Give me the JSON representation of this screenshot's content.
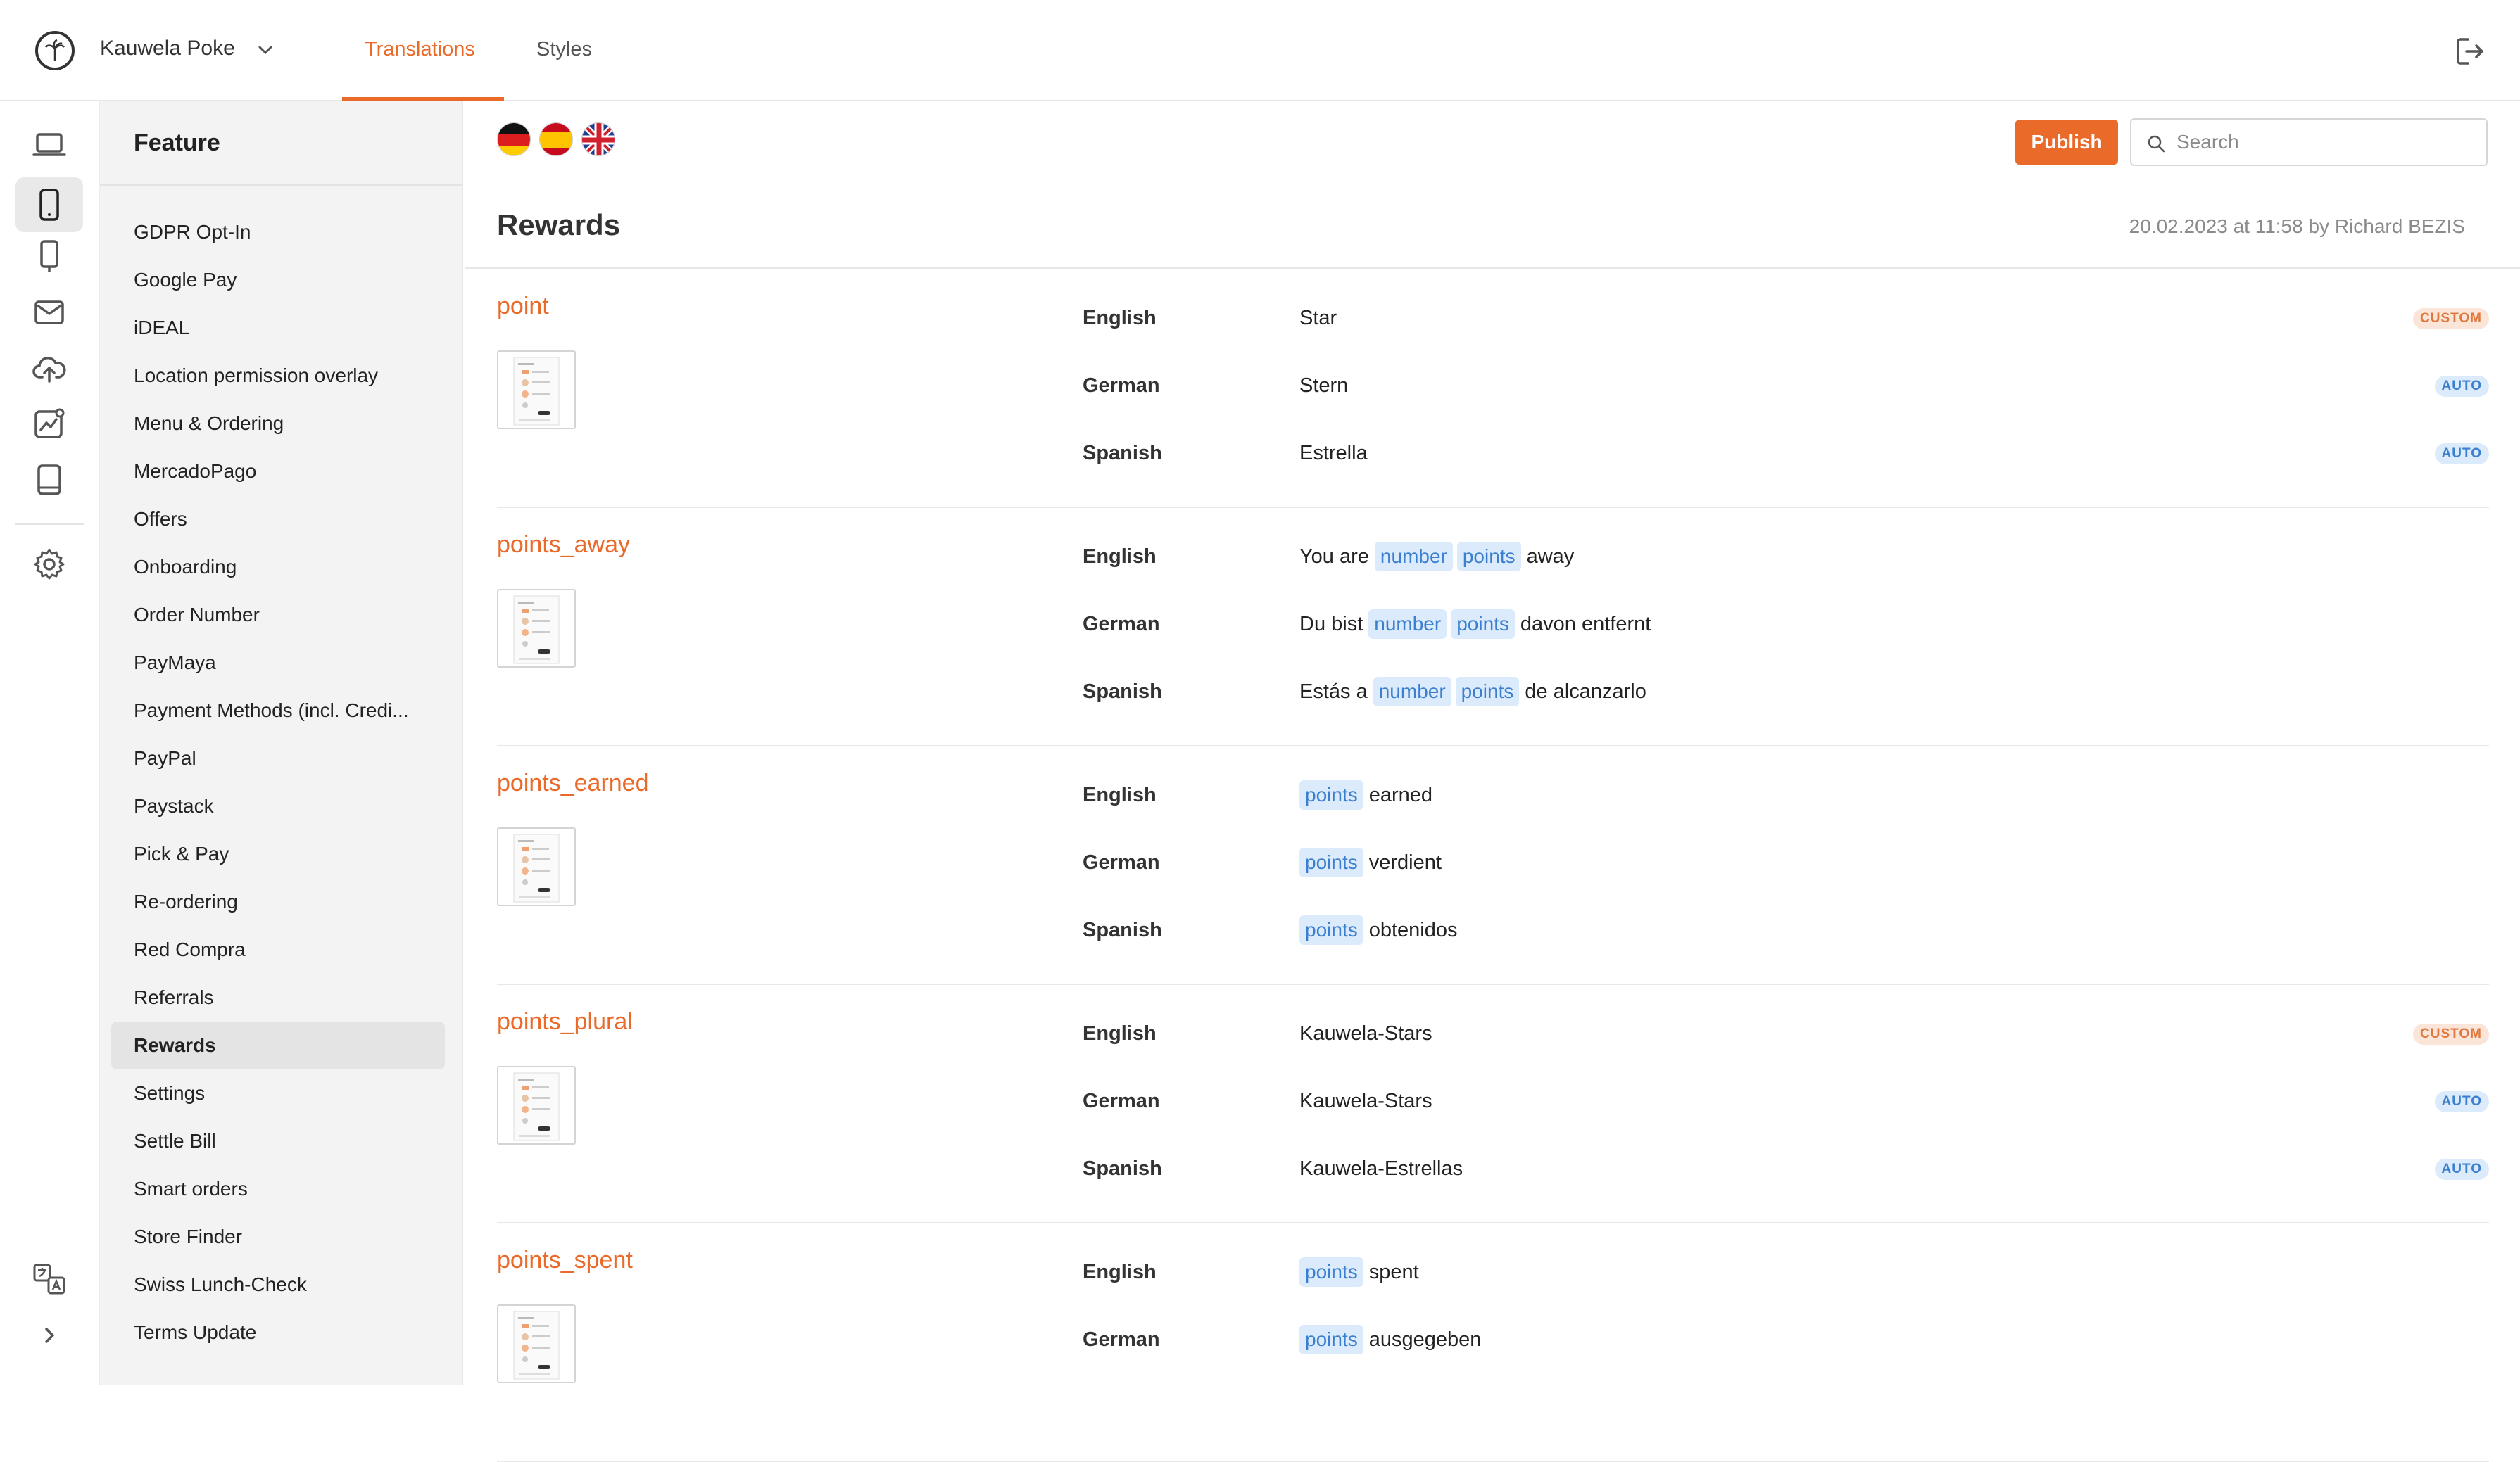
{
  "header": {
    "brand_name": "Kauwela Poke",
    "tabs": [
      {
        "label": "Translations",
        "active": true
      },
      {
        "label": "Styles",
        "active": false
      }
    ]
  },
  "rail": {
    "icons": [
      "laptop-icon",
      "phone-icon",
      "kiosk-icon",
      "mail-icon",
      "cloud-upload-icon",
      "analytics-icon",
      "tablet-icon",
      "settings-icon",
      "translate-icon",
      "chevron-right-icon"
    ],
    "active": "phone-icon"
  },
  "features": {
    "title": "Feature",
    "items": [
      "GDPR Opt-In",
      "Google Pay",
      "iDEAL",
      "Location permission overlay",
      "Menu & Ordering",
      "MercadoPago",
      "Offers",
      "Onboarding",
      "Order Number",
      "PayMaya",
      "Payment Methods (incl. Credi...",
      "PayPal",
      "Paystack",
      "Pick & Pay",
      "Re-ordering",
      "Red Compra",
      "Referrals",
      "Rewards",
      "Settings",
      "Settle Bill",
      "Smart orders",
      "Store Finder",
      "Swiss Lunch-Check",
      "Terms Update"
    ],
    "selected": "Rewards"
  },
  "toolbar": {
    "flags": [
      "flag-germany-icon",
      "flag-spain-icon",
      "flag-uk-icon"
    ],
    "publish_label": "Publish",
    "search_placeholder": "Search"
  },
  "page": {
    "title": "Rewards",
    "meta": "20.02.2023 at 11:58 by Richard BEZIS"
  },
  "entries": [
    {
      "key": "point",
      "rows": [
        {
          "lang": "English",
          "text": "Star",
          "badge": "CUSTOM"
        },
        {
          "lang": "German",
          "text": "Stern",
          "badge": "AUTO"
        },
        {
          "lang": "Spanish",
          "text": "Estrella",
          "badge": "AUTO"
        }
      ]
    },
    {
      "key": "points_away",
      "rows": [
        {
          "lang": "English",
          "pre": "You are",
          "chips": [
            "number",
            "points"
          ],
          "post": "away"
        },
        {
          "lang": "German",
          "pre": "Du bist",
          "chips": [
            "number",
            "points"
          ],
          "post": "davon entfernt"
        },
        {
          "lang": "Spanish",
          "pre": "Estás a",
          "chips": [
            "number",
            "points"
          ],
          "post": "de alcanzarlo"
        }
      ]
    },
    {
      "key": "points_earned",
      "rows": [
        {
          "lang": "English",
          "chips": [
            "points"
          ],
          "post": "earned"
        },
        {
          "lang": "German",
          "chips": [
            "points"
          ],
          "post": "verdient"
        },
        {
          "lang": "Spanish",
          "chips": [
            "points"
          ],
          "post": "obtenidos"
        }
      ]
    },
    {
      "key": "points_plural",
      "rows": [
        {
          "lang": "English",
          "text": "Kauwela-Stars",
          "badge": "CUSTOM"
        },
        {
          "lang": "German",
          "text": "Kauwela-Stars",
          "badge": "AUTO"
        },
        {
          "lang": "Spanish",
          "text": "Kauwela-Estrellas",
          "badge": "AUTO"
        }
      ]
    },
    {
      "key": "points_spent",
      "rows": [
        {
          "lang": "English",
          "chips": [
            "points"
          ],
          "post": "spent"
        },
        {
          "lang": "German",
          "chips": [
            "points"
          ],
          "post": "ausgegeben"
        }
      ]
    }
  ],
  "colors": {
    "accent": "#ea6a2a",
    "chip_bg": "#dcebfb",
    "chip_text": "#3a7fd0"
  }
}
